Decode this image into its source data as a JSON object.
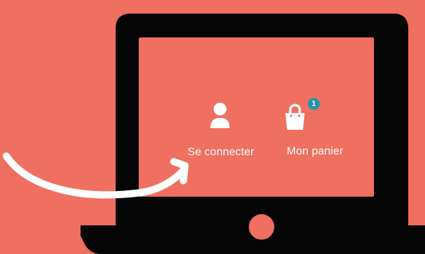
{
  "scene": {
    "background_color": "#ef6f61",
    "device_color": "#050505",
    "arrow_color": "#ffffff"
  },
  "header": {
    "login": {
      "label": "Se connecter",
      "icon": "user-icon"
    },
    "cart": {
      "label": "Mon panier",
      "icon": "shopping-bag-icon",
      "badge_count": "1",
      "badge_color": "#1f95a9"
    }
  }
}
